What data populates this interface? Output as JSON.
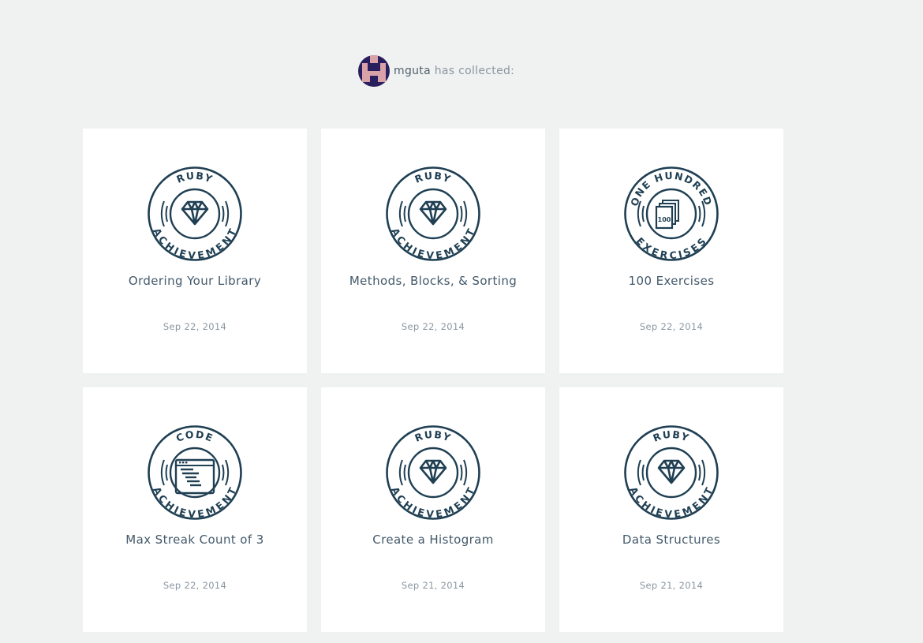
{
  "header": {
    "username": "mguta",
    "suffix": "has collected:"
  },
  "colors": {
    "background": "#f0f2f1",
    "card": "#ffffff",
    "badge": "#1f3f53",
    "avatar_bg": "#2a1f5e",
    "avatar_fg": "#d9a2a9"
  },
  "achievements": [
    {
      "title": "Ordering Your Library",
      "date": "Sep 22, 2014",
      "badge": {
        "top": "RUBY",
        "bottom": "ACHIEVEMENT",
        "icon": "ruby-gem-icon"
      }
    },
    {
      "title": "Methods, Blocks, & Sorting",
      "date": "Sep 22, 2014",
      "badge": {
        "top": "RUBY",
        "bottom": "ACHIEVEMENT",
        "icon": "ruby-gem-icon"
      }
    },
    {
      "title": "100 Exercises",
      "date": "Sep 22, 2014",
      "badge": {
        "top": "ONE HUNDRED",
        "bottom": "EXERCISES",
        "icon": "exercise-pages-icon",
        "icon_text": "100"
      }
    },
    {
      "title": "Max Streak Count of 3",
      "date": "Sep 22, 2014",
      "badge": {
        "top": "CODE",
        "bottom": "ACHIEVEMENT",
        "icon": "code-window-icon"
      }
    },
    {
      "title": "Create a Histogram",
      "date": "Sep 21, 2014",
      "badge": {
        "top": "RUBY",
        "bottom": "ACHIEVEMENT",
        "icon": "ruby-gem-icon"
      }
    },
    {
      "title": "Data Structures",
      "date": "Sep 21, 2014",
      "badge": {
        "top": "RUBY",
        "bottom": "ACHIEVEMENT",
        "icon": "ruby-gem-icon"
      }
    }
  ]
}
